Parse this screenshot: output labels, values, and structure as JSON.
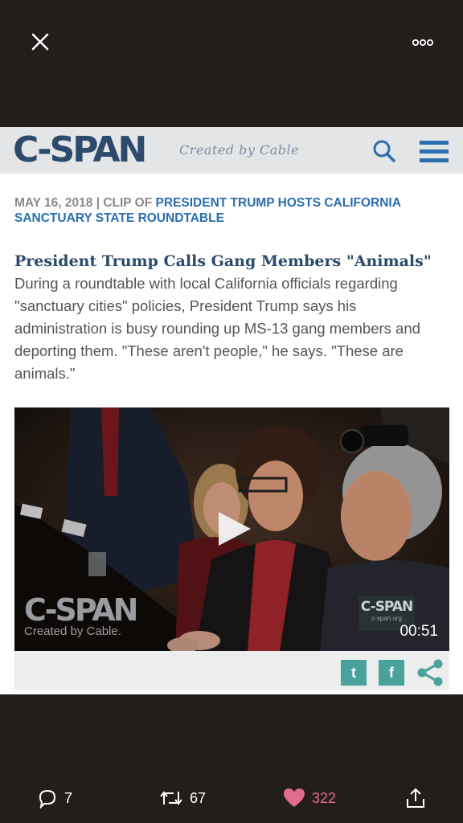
{
  "topbar": {
    "close_icon": "close-icon",
    "more_icon": "more-icon"
  },
  "cspan": {
    "logo": "C-SPAN",
    "tagline": "Created by Cable",
    "search_icon": "search-icon",
    "menu_icon": "menu-icon"
  },
  "clip": {
    "date": "MAY 16, 2018",
    "clip_prefix": "CLIP OF",
    "program_link": "PRESIDENT TRUMP HOSTS CALIFORNIA SANCTUARY STATE ROUNDTABLE",
    "title": "President Trump Calls Gang Members \"Animals\"",
    "description": "During a roundtable with local California officials regarding \"sanctuary cities\" policies, President Trump says his administration is busy rounding up MS-13 gang members and deporting them. \"These aren't people,\" he says. \"These are animals.\""
  },
  "video": {
    "watermark_logo": "C-SPAN",
    "watermark_sub": "Created by Cable.",
    "corner_logo": "C-SPAN",
    "corner_sub": "c-span.org",
    "duration": "00:51",
    "play_icon": "play-icon"
  },
  "share": {
    "twitter_label": "t",
    "facebook_label": "f",
    "share_icon": "share-icon"
  },
  "actions": {
    "replies": "7",
    "retweets": "67",
    "likes": "322",
    "colors": {
      "like": "#e36b8e",
      "icon": "#ffffff"
    }
  }
}
